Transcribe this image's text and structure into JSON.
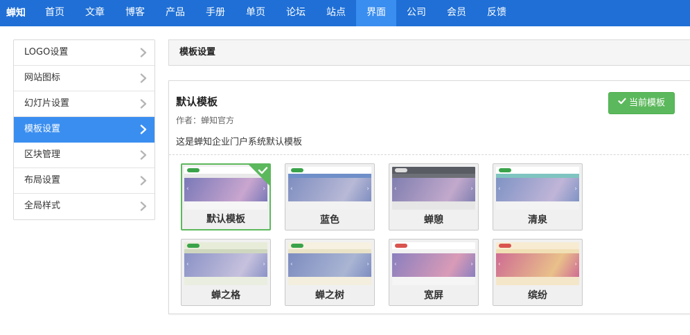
{
  "nav": {
    "brand": "蝉知",
    "items": [
      "首页",
      "文章",
      "博客",
      "产品",
      "手册",
      "单页",
      "论坛",
      "站点",
      "界面",
      "公司",
      "会员",
      "反馈"
    ],
    "active_index": 8
  },
  "sidebar": {
    "items": [
      {
        "label": "LOGO设置"
      },
      {
        "label": "网站图标"
      },
      {
        "label": "幻灯片设置"
      },
      {
        "label": "模板设置"
      },
      {
        "label": "区块管理"
      },
      {
        "label": "布局设置"
      },
      {
        "label": "全局样式"
      }
    ],
    "active_index": 3
  },
  "panel": {
    "header": "模板设置",
    "template": {
      "title": "默认模板",
      "author": "作者：蝉知官方",
      "description": "这是蝉知企业门户系统默认模板",
      "current_button": "当前模板"
    }
  },
  "themes": [
    {
      "name": "默认模板",
      "selected": true,
      "colors": {
        "bar": "#ffffff",
        "menu": "#e9e9e9",
        "hero": "#7a79b8",
        "hero2": "#c9a6cf",
        "foot": "#f6f6f6",
        "logo": "#3aa34a"
      }
    },
    {
      "name": "蓝色",
      "selected": false,
      "colors": {
        "bar": "#ffffff",
        "menu": "#6f8fc9",
        "hero": "#7f8ec0",
        "hero2": "#b8b9d6",
        "foot": "#f2f2f2",
        "logo": "#3aa34a"
      }
    },
    {
      "name": "蝉憩",
      "selected": false,
      "colors": {
        "bar": "#5a5c63",
        "menu": "#6e7077",
        "hero": "#807fb0",
        "hero2": "#c2a9cc",
        "foot": "#e6e6e6",
        "logo": "#dddddd"
      }
    },
    {
      "name": "清泉",
      "selected": false,
      "colors": {
        "bar": "#ffffff",
        "menu": "#7fc4c0",
        "hero": "#7f93c4",
        "hero2": "#c0b5d8",
        "foot": "#f3f3f3",
        "logo": "#3aa34a"
      }
    },
    {
      "name": "蝉之格",
      "selected": false,
      "colors": {
        "bar": "#e7ecd9",
        "menu": "#cfd7bf",
        "hero": "#8a92c6",
        "hero2": "#c6c1dd",
        "foot": "#e9eee0",
        "logo": "#3aa34a"
      }
    },
    {
      "name": "蝉之树",
      "selected": false,
      "colors": {
        "bar": "#f6f1e0",
        "menu": "#e9e2c7",
        "hero": "#7d8cc0",
        "hero2": "#aab5d3",
        "foot": "#f3eedd",
        "logo": "#3aa34a"
      }
    },
    {
      "name": "宽屏",
      "selected": false,
      "colors": {
        "bar": "#ffffff",
        "menu": "#f2f2f2",
        "hero": "#8a7fbf",
        "hero2": "#d99bb7",
        "foot": "#f5f5f5",
        "logo": "#d9534f"
      }
    },
    {
      "name": "缤纷",
      "selected": false,
      "colors": {
        "bar": "#f7ecd2",
        "menu": "#f1dfb5",
        "hero": "#cf6c93",
        "hero2": "#e9c08a",
        "foot": "#f4e6c8",
        "logo": "#d9534f"
      }
    }
  ],
  "colors": {
    "nav_bg": "#1f6fd6",
    "accent": "#3a8ef0",
    "success": "#5cb85c"
  }
}
